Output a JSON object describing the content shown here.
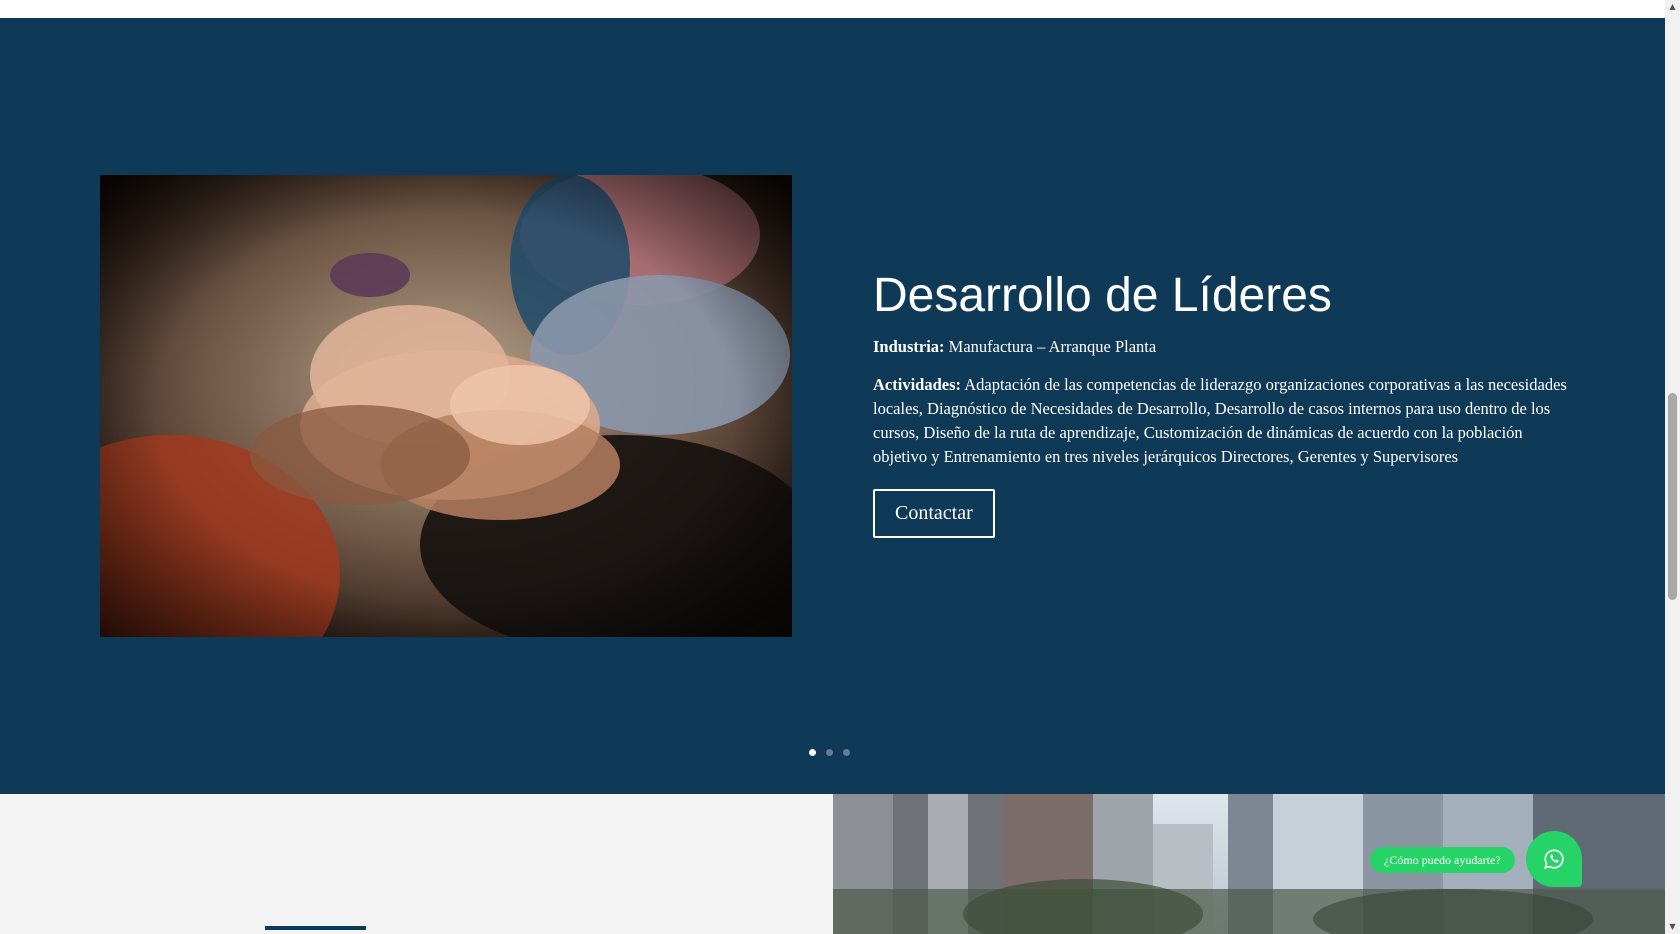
{
  "hero": {
    "title": "Desarrollo de Líderes",
    "industry_label": "Industria:",
    "industry_value": "Manufactura – Arranque Planta",
    "activities_label": "Actividades:",
    "activities_value": "Adaptación de las competencias de liderazgo organizaciones corporativas a las necesidades locales, Diagnóstico de Necesidades de Desarrollo, Desarrollo de casos internos para uso dentro de los cursos, Diseño de la ruta de aprendizaje, Customización de dinámicas de acuerdo con la población objetivo y  Entrenamiento en tres niveles jerárquicos Directores, Gerentes y Supervisores",
    "button_label": "Contactar",
    "background_color": "#0f3a57"
  },
  "slider": {
    "total_slides": 3,
    "active_index": 0
  },
  "whatsapp": {
    "bubble_text": "¿Cómo puedo ayudarte?",
    "icon": "whatsapp-icon",
    "color": "#25d366"
  },
  "scrollbar": {
    "up_icon": "scroll-up-arrow-icon",
    "down_icon": "scroll-down-arrow-icon"
  }
}
